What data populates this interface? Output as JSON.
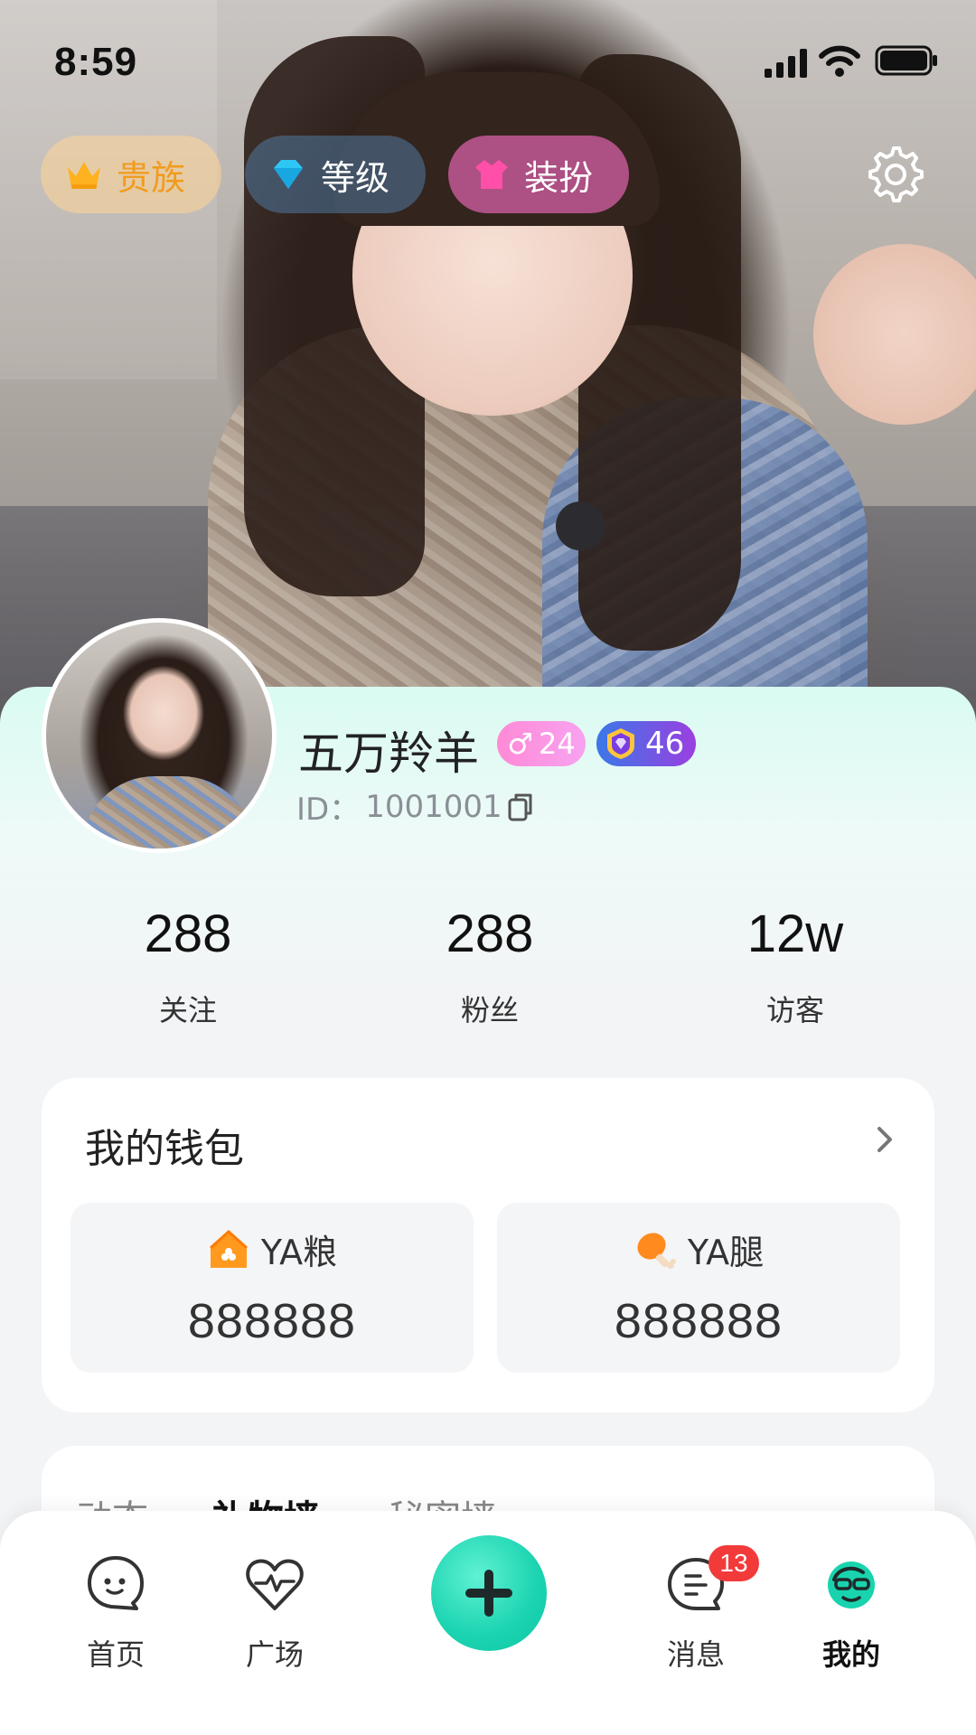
{
  "status_bar": {
    "time": "8:59"
  },
  "top_chips": {
    "noble": {
      "label": "贵族",
      "icon": "crown-icon",
      "color": "#f29b1d"
    },
    "level": {
      "label": "等级",
      "icon": "diamond-icon"
    },
    "dress": {
      "label": "装扮",
      "icon": "clothes-icon"
    }
  },
  "profile": {
    "nickname": "五万羚羊",
    "gender_symbol": "♂",
    "age": "24",
    "level": "46",
    "id_label": "ID：",
    "id_value": "1001001"
  },
  "stats": [
    {
      "value": "288",
      "label": "关注"
    },
    {
      "value": "288",
      "label": "粉丝"
    },
    {
      "value": "12w",
      "label": "访客"
    }
  ],
  "wallet": {
    "title": "我的钱包",
    "items": [
      {
        "name": "YA粮",
        "value": "888888",
        "icon": "house-coin-icon"
      },
      {
        "name": "YA腿",
        "value": "888888",
        "icon": "drumstick-icon"
      }
    ]
  },
  "tabs": [
    {
      "label": "动态"
    },
    {
      "label": "礼物墙",
      "active": true
    },
    {
      "label": "秘密墙"
    }
  ],
  "bottom_nav": {
    "items": [
      {
        "label": "首页",
        "icon": "chat-face-icon"
      },
      {
        "label": "广场",
        "icon": "heart-pulse-icon"
      },
      {
        "label": "消息",
        "icon": "message-icon",
        "badge": "13"
      },
      {
        "label": "我的",
        "icon": "profile-face-icon",
        "active": true
      }
    ],
    "center_button_icon": "plus-icon"
  },
  "colors": {
    "accent": "#1ad3b0",
    "badge_red": "#f23a3a",
    "gender_pink": "#ff8ad6",
    "level_gradient_start": "#3a78e8",
    "level_gradient_end": "#9b3fe0"
  }
}
